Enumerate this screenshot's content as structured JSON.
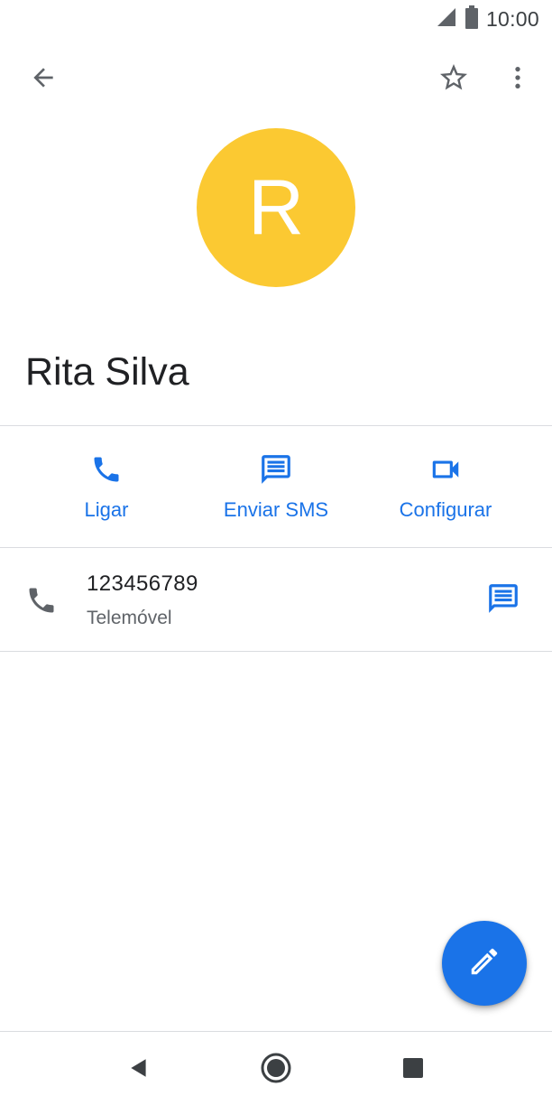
{
  "status_bar": {
    "time": "10:00",
    "icons": [
      "signal-icon",
      "battery-icon"
    ]
  },
  "app_bar": {
    "icons": [
      "arrow-back-icon",
      "star-outline-icon",
      "more-vert-icon"
    ]
  },
  "contact": {
    "initial": "R",
    "name": "Rita Silva",
    "avatar_color": "#fbc932"
  },
  "actions": [
    {
      "label": "Ligar",
      "icon": "phone-icon"
    },
    {
      "label": "Enviar SMS",
      "icon": "message-icon"
    },
    {
      "label": "Configurar",
      "icon": "videocam-icon"
    }
  ],
  "phone_entry": {
    "number": "123456789",
    "type": "Telemóvel",
    "icon": "phone-icon",
    "action_icon": "message-icon"
  },
  "fab": {
    "icon": "edit-pencil-icon"
  },
  "nav_bar": {
    "icons": [
      "nav-back-icon",
      "nav-home-icon",
      "nav-recents-icon"
    ]
  },
  "colors": {
    "accent": "#1a73e8",
    "icon_gray": "#5f6368",
    "text_primary": "#202124",
    "text_secondary": "#5f6368",
    "divider": "#dadce0",
    "avatar": "#fbc932"
  }
}
